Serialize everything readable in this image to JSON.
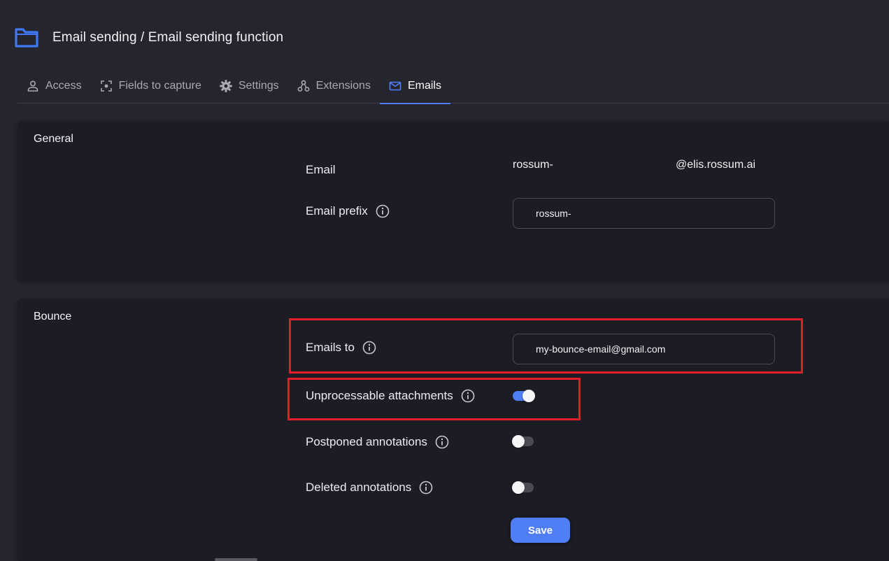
{
  "header": {
    "title": "Email sending / Email sending function",
    "icon": "folder-icon",
    "icon_color": "#3f78f5"
  },
  "tabs": [
    {
      "label": "Access",
      "icon": "user-icon",
      "active": false
    },
    {
      "label": "Fields to capture",
      "icon": "capture-icon",
      "active": false
    },
    {
      "label": "Settings",
      "icon": "gear-icon",
      "active": false
    },
    {
      "label": "Extensions",
      "icon": "extensions-icon",
      "active": false
    },
    {
      "label": "Emails",
      "icon": "mail-icon",
      "active": true
    }
  ],
  "general": {
    "title": "General",
    "email_label": "Email",
    "email_prefix_text": "rossum-",
    "email_domain_text": "@elis.rossum.ai",
    "email_prefix_label": "Email prefix",
    "email_prefix_value": "rossum-"
  },
  "bounce": {
    "title": "Bounce",
    "emails_to_label": "Emails to",
    "emails_to_value": "my-bounce-email@gmail.com",
    "unprocessable_label": "Unprocessable attachments",
    "unprocessable_on": true,
    "postponed_label": "Postponed annotations",
    "postponed_on": false,
    "deleted_label": "Deleted annotations",
    "deleted_on": false,
    "save_label": "Save"
  },
  "colors": {
    "accent": "#4f7ef7",
    "highlight": "#e11d2a",
    "background": "#25252d",
    "card": "#1c1c24"
  }
}
